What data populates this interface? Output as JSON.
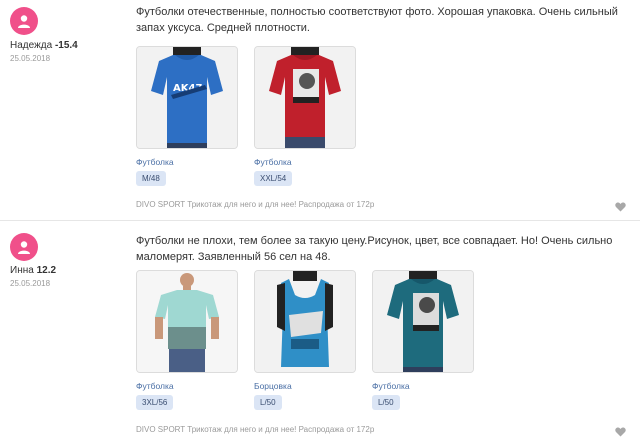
{
  "colors": {
    "avatar": "#f0508a",
    "link": "#4a6fa5",
    "badge_bg": "#dbe5f5",
    "muted": "#9a9a9a"
  },
  "reviews": [
    {
      "user": "Надежда",
      "rating": "-15.4",
      "date": "25.05.2018",
      "text": "Футболки отечественные, полностью соответствуют фото. Хорошая упаковка. Очень сильный запах уксуса. Средней плотности.",
      "items": [
        {
          "type": "Футболка",
          "size": "M/48",
          "image": "blue-tshirt-ak47"
        },
        {
          "type": "Футболка",
          "size": "XXL/54",
          "image": "red-tshirt-print"
        }
      ],
      "source": "DIVO SPORT Трикотаж для него и для нее! Распродажа от 172р"
    },
    {
      "user": "Инна",
      "rating": "12.2",
      "date": "25.05.2018",
      "text": "Футболки не плохи, тем более за такую цену.Рисунок, цвет, все совпадает. Но! Очень сильно маломерят. Заявленный 56 сел на 48.",
      "items": [
        {
          "type": "Футболка",
          "size": "3XL/56",
          "image": "mint-tshirt-model"
        },
        {
          "type": "Борцовка",
          "size": "L/50",
          "image": "blue-tank-top-print"
        },
        {
          "type": "Футболка",
          "size": "L/50",
          "image": "teal-tshirt-print"
        }
      ],
      "source": "DIVO SPORT Трикотаж для него и для нее! Распродажа от 172р"
    }
  ]
}
